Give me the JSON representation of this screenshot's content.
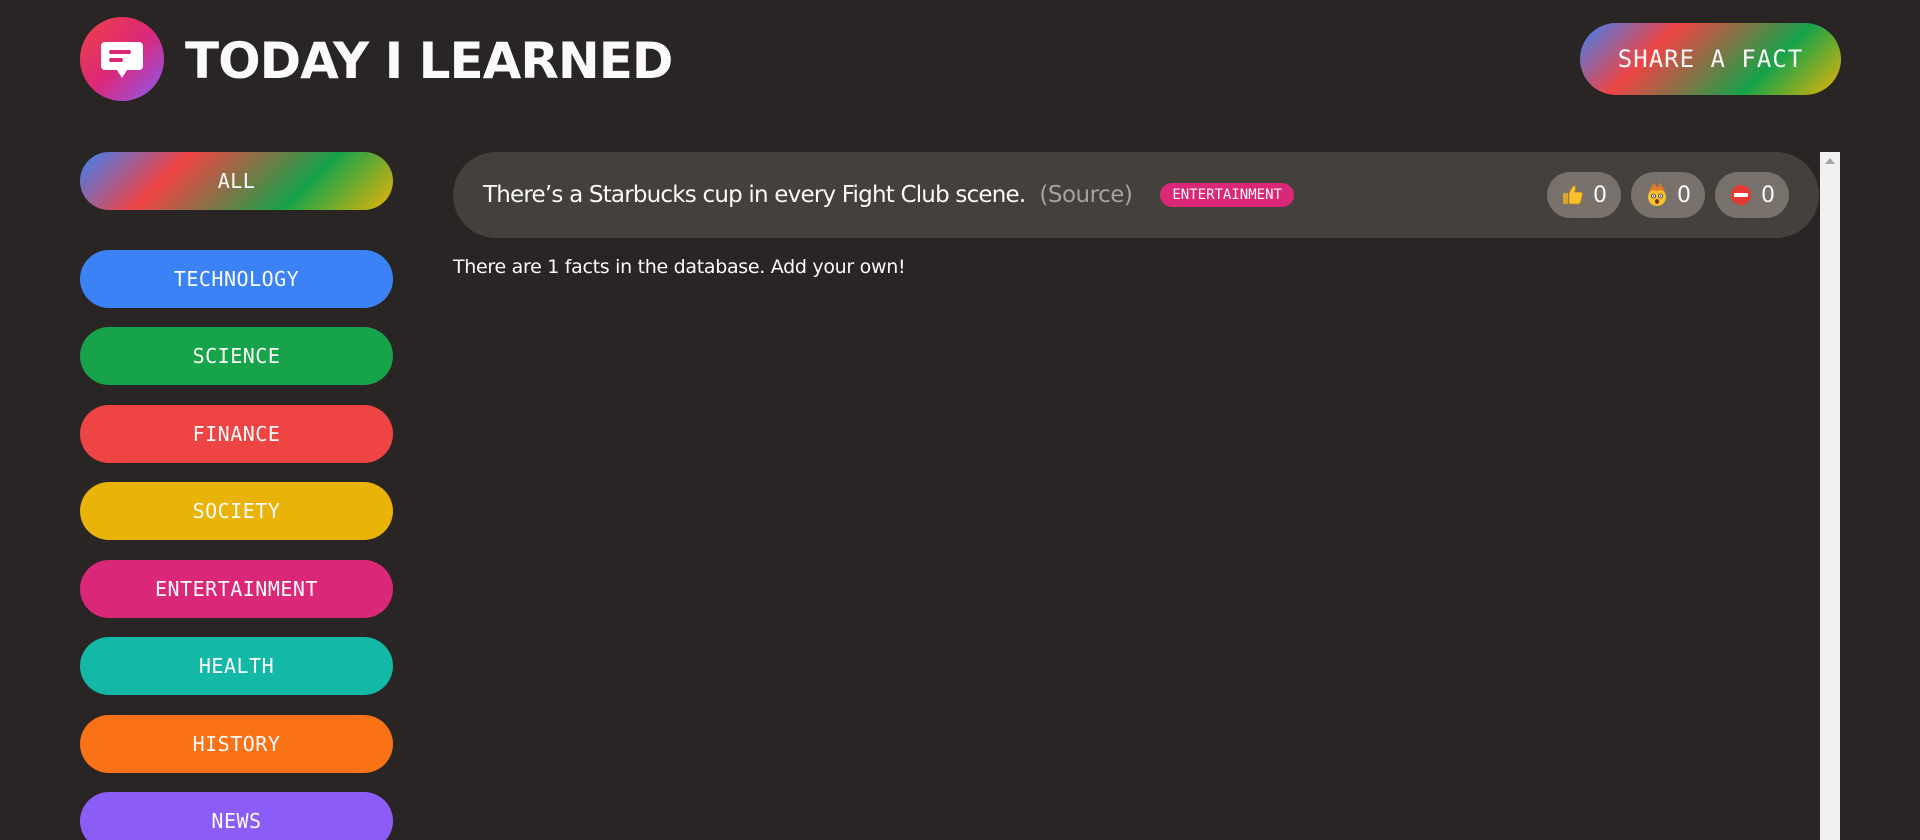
{
  "header": {
    "title": "TODAY I LEARNED",
    "share_label": "SHARE A FACT"
  },
  "sidebar": {
    "all_label": "ALL",
    "categories": [
      {
        "label": "TECHNOLOGY",
        "color": "#3b82f6"
      },
      {
        "label": "SCIENCE",
        "color": "#16a34a"
      },
      {
        "label": "FINANCE",
        "color": "#ef4444"
      },
      {
        "label": "SOCIETY",
        "color": "#eab308"
      },
      {
        "label": "ENTERTAINMENT",
        "color": "#db2777"
      },
      {
        "label": "HEALTH",
        "color": "#14b8a6"
      },
      {
        "label": "HISTORY",
        "color": "#f97316"
      },
      {
        "label": "NEWS",
        "color": "#8b5cf6"
      }
    ]
  },
  "facts": [
    {
      "text": "There’s a Starbucks cup in every Fight Club scene.",
      "source_label": "(Source)",
      "category": "ENTERTAINMENT",
      "category_color": "#db2777",
      "votes": [
        {
          "icon": "thumbs-up-icon",
          "count": "0"
        },
        {
          "icon": "mind-blown-icon",
          "count": "0"
        },
        {
          "icon": "no-entry-icon",
          "count": "0"
        }
      ]
    }
  ],
  "footer_note": "There are 1 facts in the database. Add your own!",
  "colors": {
    "background": "#292524",
    "card": "#44403c",
    "vote_button": "#78716c"
  }
}
